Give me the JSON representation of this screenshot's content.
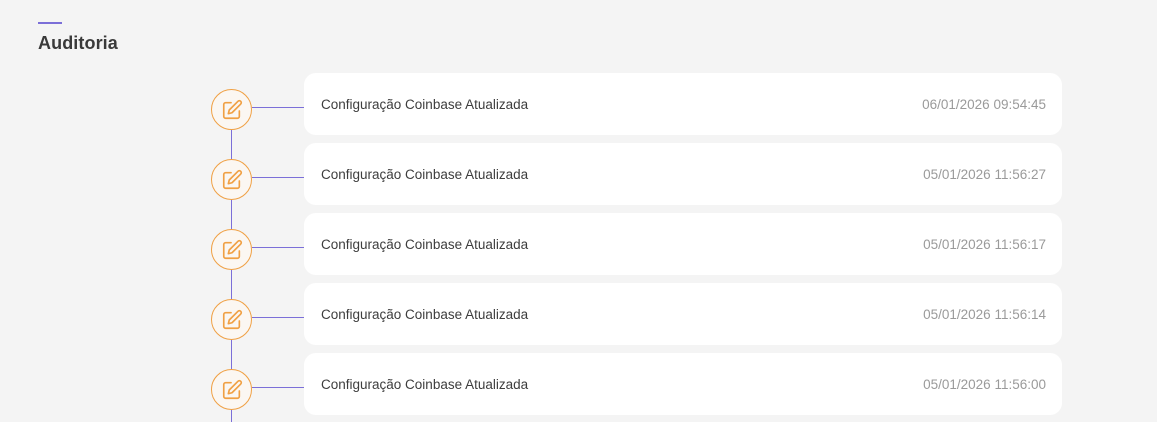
{
  "section": {
    "title": "Auditoria"
  },
  "entries": [
    {
      "icon": "edit-icon",
      "text": "Configuração Coinbase Atualizada",
      "timestamp": "06/01/2026 09:54:45"
    },
    {
      "icon": "edit-icon",
      "text": "Configuração Coinbase Atualizada",
      "timestamp": "05/01/2026 11:56:27"
    },
    {
      "icon": "edit-icon",
      "text": "Configuração Coinbase Atualizada",
      "timestamp": "05/01/2026 11:56:17"
    },
    {
      "icon": "edit-icon",
      "text": "Configuração Coinbase Atualizada",
      "timestamp": "05/01/2026 11:56:14"
    },
    {
      "icon": "edit-icon",
      "text": "Configuração Coinbase Atualizada",
      "timestamp": "05/01/2026 11:56:00"
    }
  ],
  "colors": {
    "background": "#f4f4f4",
    "accent": "#7b6fd8",
    "icon": "#f0a043",
    "card": "#ffffff",
    "text": "#3d3d3d",
    "timestamp": "#9a9a9a"
  }
}
